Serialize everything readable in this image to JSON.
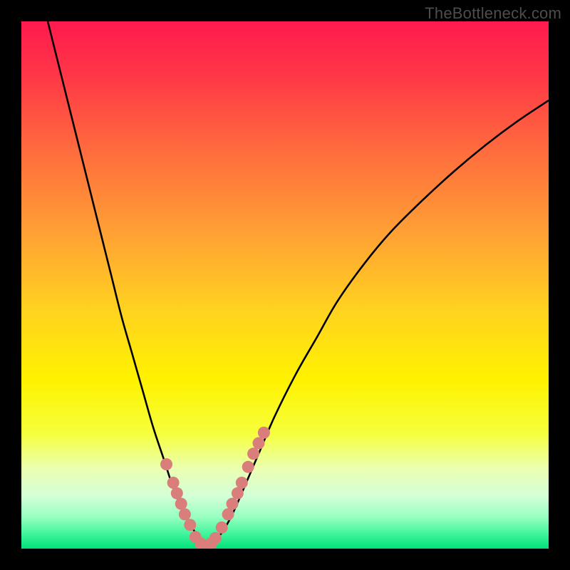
{
  "watermark": "TheBottleneck.com",
  "colors": {
    "frame": "#000000",
    "curve": "#000000",
    "marker_fill": "#da7e7b",
    "marker_stroke": "#da7e7b"
  },
  "gradient_stops": [
    {
      "offset": 0.0,
      "color": "#ff1a4e"
    },
    {
      "offset": 0.1,
      "color": "#ff3647"
    },
    {
      "offset": 0.24,
      "color": "#ff6a3e"
    },
    {
      "offset": 0.4,
      "color": "#ffa034"
    },
    {
      "offset": 0.55,
      "color": "#ffd31f"
    },
    {
      "offset": 0.68,
      "color": "#fff200"
    },
    {
      "offset": 0.78,
      "color": "#f6ff3b"
    },
    {
      "offset": 0.85,
      "color": "#eaffb3"
    },
    {
      "offset": 0.9,
      "color": "#d4ffd7"
    },
    {
      "offset": 0.94,
      "color": "#98ffc1"
    },
    {
      "offset": 0.97,
      "color": "#46f59f"
    },
    {
      "offset": 1.0,
      "color": "#00e27a"
    }
  ],
  "chart_data": {
    "type": "line",
    "title": "",
    "xlabel": "",
    "ylabel": "",
    "xlim": [
      0,
      100
    ],
    "ylim": [
      0,
      100
    ],
    "series": [
      {
        "name": "left-curve",
        "x": [
          5,
          7,
          9,
          11,
          13,
          15,
          17,
          19,
          21,
          23,
          25,
          27,
          29,
          31,
          33,
          34,
          35
        ],
        "y": [
          100,
          92,
          84,
          76,
          68,
          60,
          52,
          44,
          37,
          30,
          23,
          17,
          11,
          6.5,
          3,
          1.5,
          0.5
        ]
      },
      {
        "name": "right-curve",
        "x": [
          35,
          36,
          38,
          40,
          42,
          45,
          48,
          52,
          56,
          60,
          65,
          70,
          76,
          82,
          88,
          94,
          100
        ],
        "y": [
          0.5,
          1,
          3,
          6.5,
          11,
          18,
          25,
          33,
          40,
          47,
          54,
          60,
          66,
          71.5,
          76.5,
          81,
          85
        ]
      }
    ],
    "markers": [
      {
        "x": 27.5,
        "y": 16
      },
      {
        "x": 28.8,
        "y": 12.5
      },
      {
        "x": 29.5,
        "y": 10.5
      },
      {
        "x": 30.3,
        "y": 8.5
      },
      {
        "x": 31.0,
        "y": 6.5
      },
      {
        "x": 32.0,
        "y": 4.5
      },
      {
        "x": 33.0,
        "y": 2.2
      },
      {
        "x": 34.0,
        "y": 1.0
      },
      {
        "x": 35.0,
        "y": 0.5
      },
      {
        "x": 36.0,
        "y": 1.0
      },
      {
        "x": 36.8,
        "y": 2.0
      },
      {
        "x": 38.0,
        "y": 4.0
      },
      {
        "x": 39.2,
        "y": 6.5
      },
      {
        "x": 40.0,
        "y": 8.5
      },
      {
        "x": 41.0,
        "y": 10.5
      },
      {
        "x": 41.8,
        "y": 12.5
      },
      {
        "x": 43.0,
        "y": 15.5
      },
      {
        "x": 44.0,
        "y": 18.0
      },
      {
        "x": 45.0,
        "y": 20.0
      },
      {
        "x": 46.0,
        "y": 22.0
      }
    ]
  }
}
